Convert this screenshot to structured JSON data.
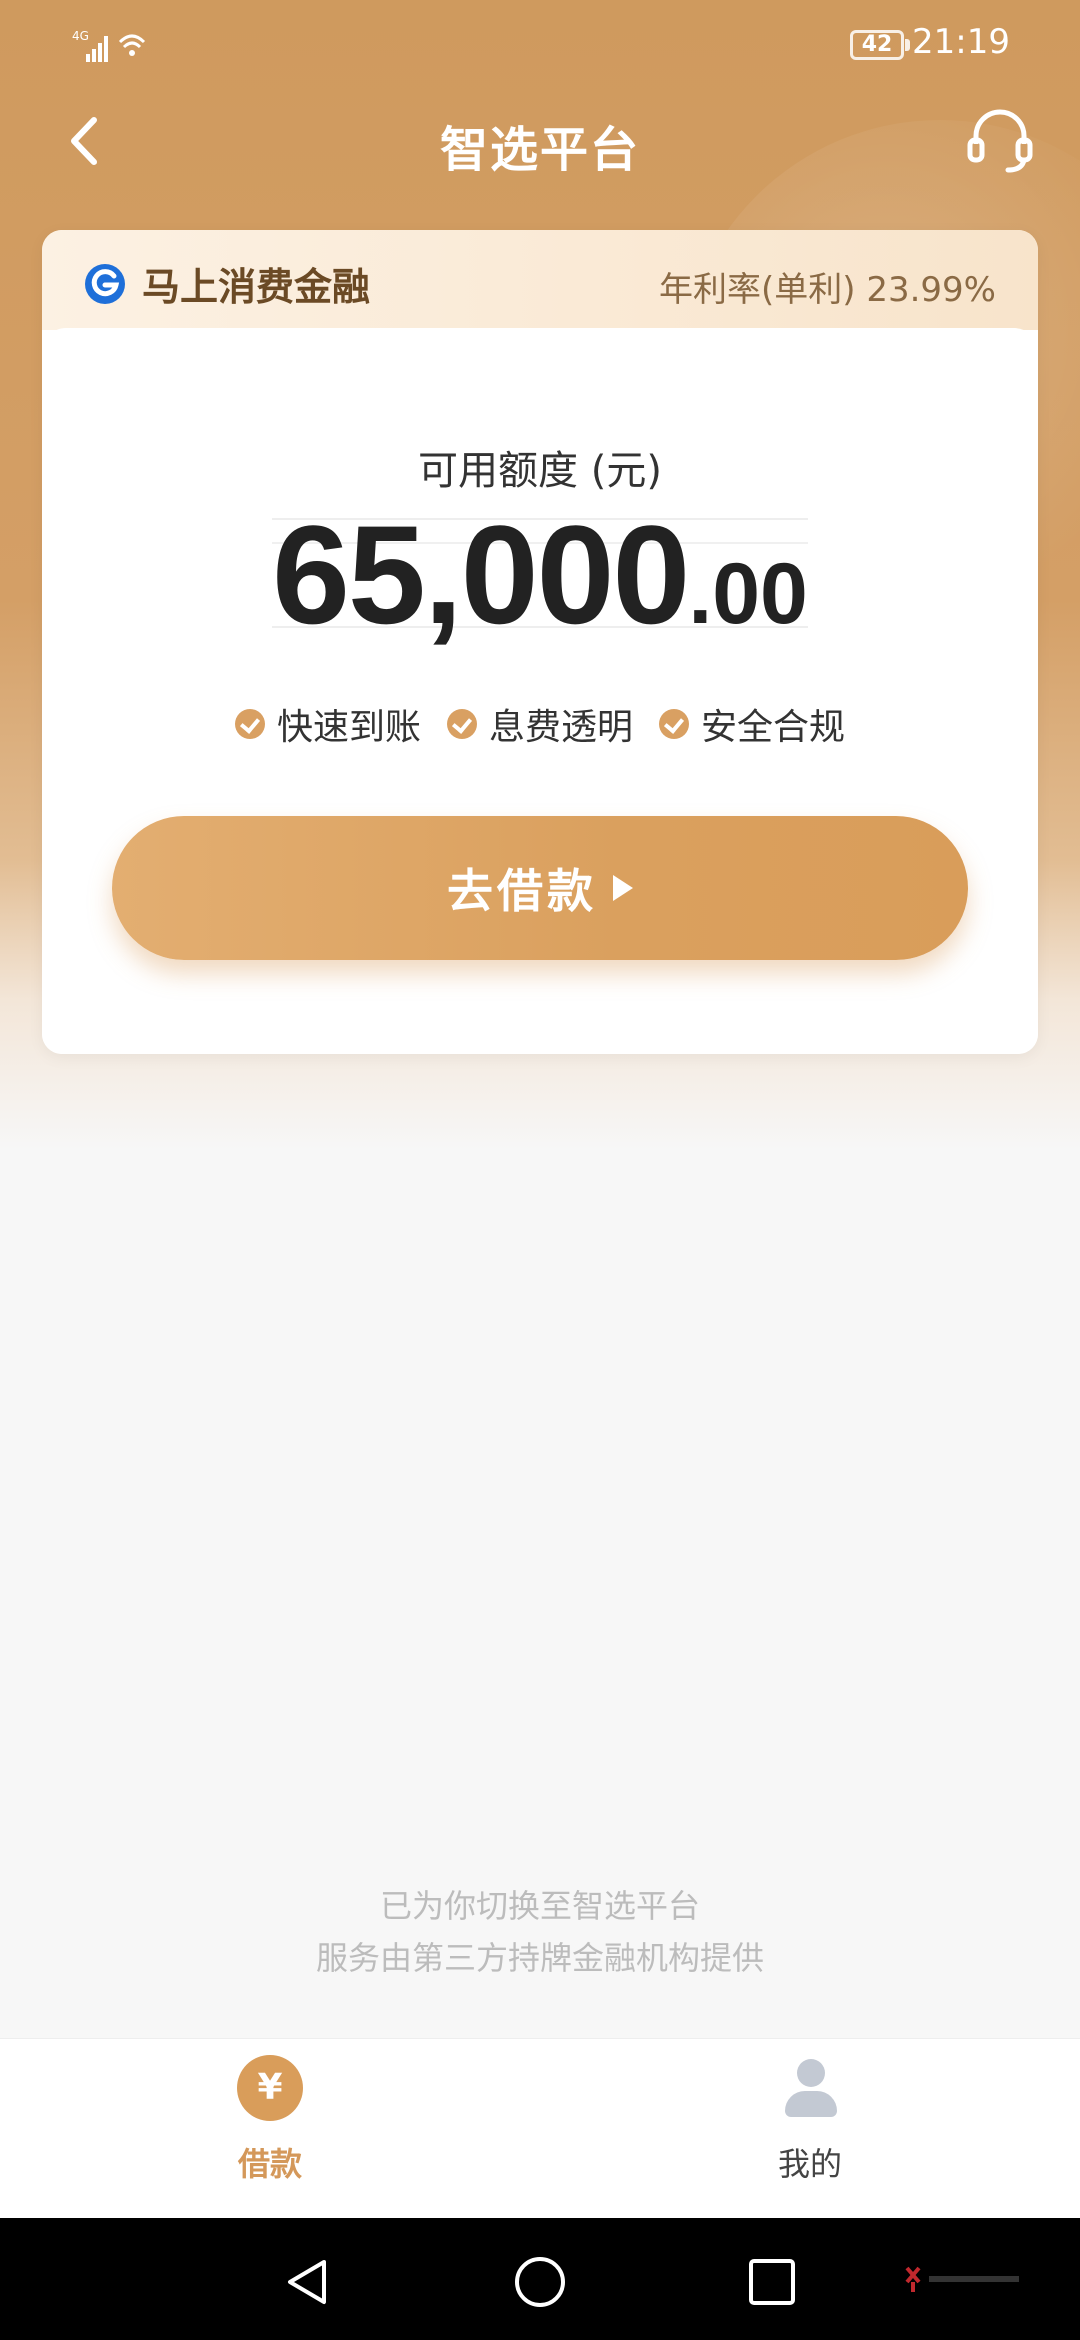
{
  "status_bar": {
    "network": "4G",
    "battery": "42",
    "time": "21:19"
  },
  "nav": {
    "title": "智选平台",
    "back_icon": "chevron-left-icon",
    "support_icon": "headset-icon"
  },
  "card": {
    "lender_name": "马上消费金融",
    "rate": "年利率(单利) 23.99%",
    "limit_label": "可用额度 (元)",
    "amount_integer": "65,000",
    "amount_decimal": ".00",
    "features": [
      "快速到账",
      "息费透明",
      "安全合规"
    ],
    "borrow_button": "去借款"
  },
  "notice": {
    "line1": "已为你切换至智选平台",
    "line2": "服务由第三方持牌金融机构提供"
  },
  "tab_bar": {
    "tabs": [
      {
        "label": "借款",
        "icon_text": "¥",
        "icon": "yen-icon",
        "active": true
      },
      {
        "label": "我的",
        "icon": "person-icon",
        "active": false
      }
    ]
  },
  "colors": {
    "brand": "#d99d5a",
    "header": "#cf9a5e",
    "background": "#f7f7f7"
  }
}
